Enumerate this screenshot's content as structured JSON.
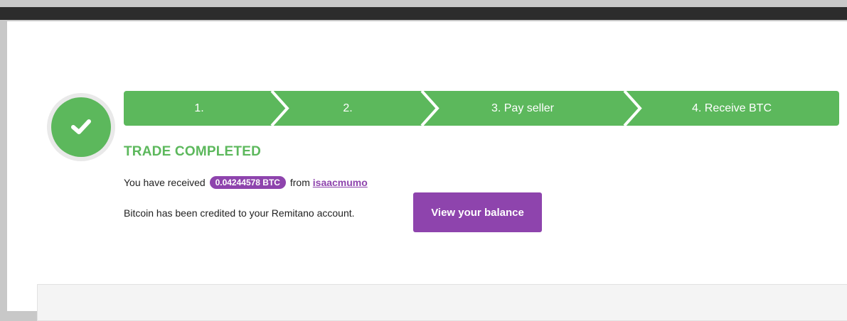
{
  "steps": [
    {
      "label": "1."
    },
    {
      "label": "2."
    },
    {
      "label": "3. Pay seller"
    },
    {
      "label": "4. Receive BTC"
    }
  ],
  "status": {
    "title": "TRADE COMPLETED",
    "icon": "check-icon"
  },
  "received": {
    "prefix": "You have received",
    "amount": "0.04244578 BTC",
    "from_label": "from",
    "seller": "isaacmumo"
  },
  "credited": {
    "text": "Bitcoin has been credited to your Remitano account.",
    "button_label": "View your balance"
  },
  "colors": {
    "success": "#5cb85c",
    "accent": "#8e44ad"
  }
}
